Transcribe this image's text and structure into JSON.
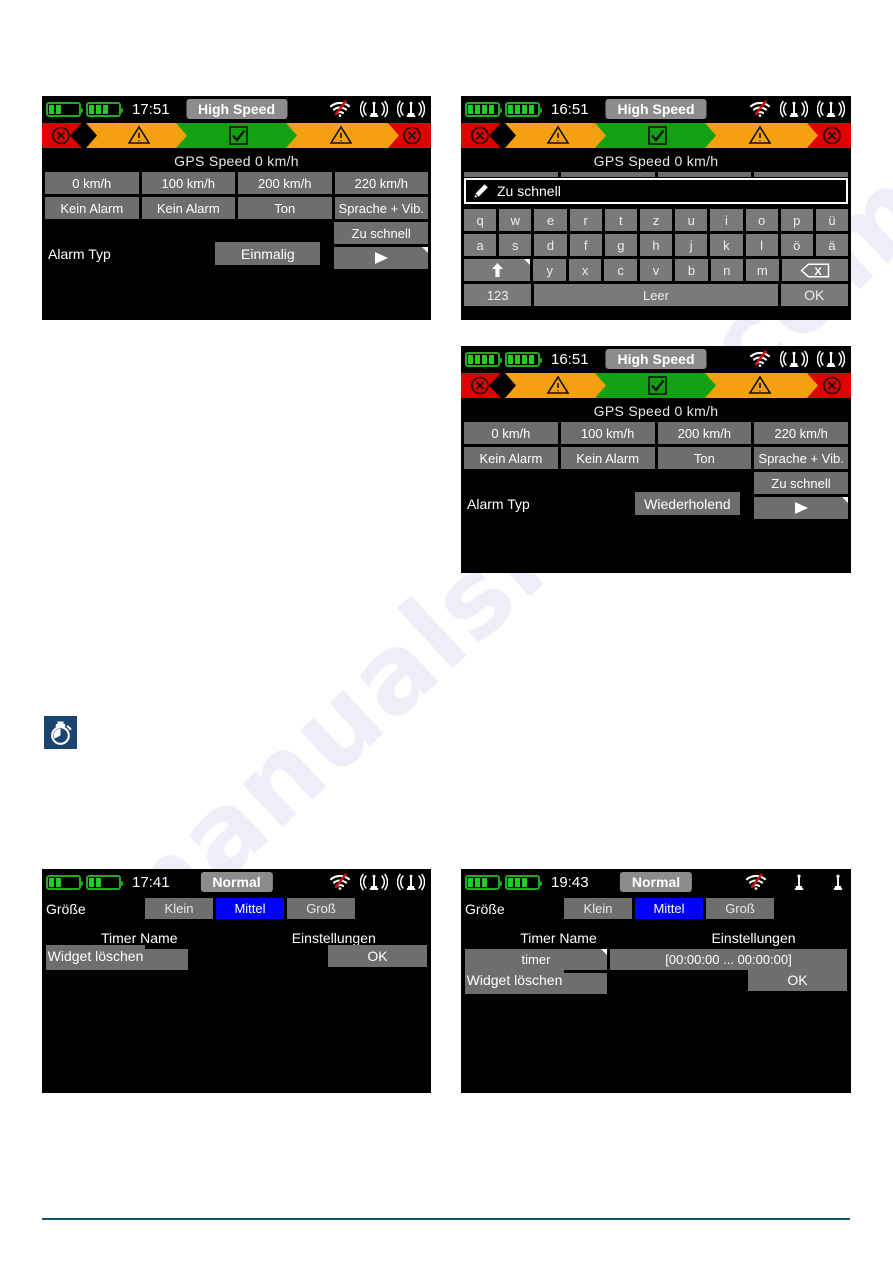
{
  "page": {
    "watermark_text": "manualshive.com",
    "rule_color": "#10556e",
    "icon_tile": {
      "name": "stopwatch-icon",
      "bg": "#1d4371"
    }
  },
  "colors": {
    "chip_grey": "#8c8c8c",
    "button_grey": "#6e6e6e",
    "key_grey": "#7a7a7a",
    "selected_blue": "#0000ff",
    "battery_green": "#22cc22",
    "status_red": "#e00000",
    "status_orange": "#f5a010",
    "status_green": "#11a111"
  },
  "telemetry_bar": {
    "segments": [
      "error-x",
      "warning-triangle",
      "ok-check",
      "warning-triangle",
      "error-x"
    ]
  },
  "screens": {
    "high_speed_einmalig": {
      "status": {
        "clock": "17:51",
        "mode": "High Speed",
        "battery_1_bars": 2,
        "battery_2_bars": 3,
        "icons": [
          "wifi-off-icon",
          "antenna-signal-icon",
          "antenna-signal-icon"
        ]
      },
      "gps_line": "GPS  Speed 0 km/h",
      "speed_buttons": [
        "0 km/h",
        "100 km/h",
        "200 km/h",
        "220 km/h"
      ],
      "alarm_buttons": [
        "Kein Alarm",
        "Kein Alarm",
        "Ton",
        "Sprache + Vib."
      ],
      "message_button": "Zu schnell",
      "play_button": "play-icon",
      "alarm_type_label": "Alarm Typ",
      "alarm_type_value": "Einmalig"
    },
    "keyboard": {
      "status": {
        "clock": "16:51",
        "mode": "High Speed",
        "battery_1_bars": 4,
        "battery_2_bars": 4,
        "icons": [
          "wifi-off-icon",
          "antenna-signal-icon",
          "antenna-signal-icon"
        ]
      },
      "gps_line": "GPS  Speed 0 km/h",
      "input_value": "Zu schnell",
      "input_icon": "pencil-icon",
      "row1": [
        "q",
        "w",
        "e",
        "r",
        "t",
        "z",
        "u",
        "i",
        "o",
        "p",
        "ü"
      ],
      "row2": [
        "a",
        "s",
        "d",
        "f",
        "g",
        "h",
        "j",
        "k",
        "l",
        "ö",
        "ä"
      ],
      "row3": [
        "y",
        "x",
        "c",
        "v",
        "b",
        "n",
        "m"
      ],
      "shift_key": "shift-up-arrow-icon",
      "backspace_key": "backspace-icon",
      "numeric_key": "123",
      "space_key": "Leer",
      "ok_key": "OK"
    },
    "high_speed_wiederholend": {
      "status": {
        "clock": "16:51",
        "mode": "High Speed",
        "battery_1_bars": 4,
        "battery_2_bars": 4,
        "icons": [
          "wifi-off-icon",
          "antenna-signal-icon",
          "antenna-signal-icon"
        ]
      },
      "gps_line": "GPS  Speed 0 km/h",
      "speed_buttons": [
        "0 km/h",
        "100 km/h",
        "200 km/h",
        "220 km/h"
      ],
      "alarm_buttons": [
        "Kein Alarm",
        "Kein Alarm",
        "Ton",
        "Sprache + Vib."
      ],
      "message_button": "Zu schnell",
      "play_button": "play-icon",
      "alarm_type_label": "Alarm Typ",
      "alarm_type_value": "Wiederholend"
    },
    "timer_widget_empty": {
      "status": {
        "clock": "17:41",
        "mode": "Normal",
        "battery_1_bars": 2,
        "battery_2_bars": 2,
        "icons": [
          "wifi-off-icon",
          "antenna-signal-icon",
          "antenna-signal-icon"
        ]
      },
      "size_label": "Größe",
      "size_options": [
        "Klein",
        "Mittel",
        "Groß"
      ],
      "size_selected": "Mittel",
      "col_header_name": "Timer Name",
      "col_header_settings": "Einstellungen",
      "add_button": "+",
      "delete_widget_button": "Widget löschen",
      "ok_button": "OK"
    },
    "timer_widget_filled": {
      "status": {
        "clock": "19:43",
        "mode": "Normal",
        "battery_1_bars": 3,
        "battery_2_bars": 3,
        "icons": [
          "wifi-off-icon",
          "antenna-plain-icon",
          "antenna-plain-icon"
        ]
      },
      "size_label": "Größe",
      "size_options": [
        "Klein",
        "Mittel",
        "Groß"
      ],
      "size_selected": "Mittel",
      "col_header_name": "Timer Name",
      "col_header_settings": "Einstellungen",
      "timer_row": {
        "name": "timer",
        "settings": "[00:00:00 ... 00:00:00]"
      },
      "add_button": "+",
      "delete_widget_button": "Widget löschen",
      "ok_button": "OK"
    }
  }
}
